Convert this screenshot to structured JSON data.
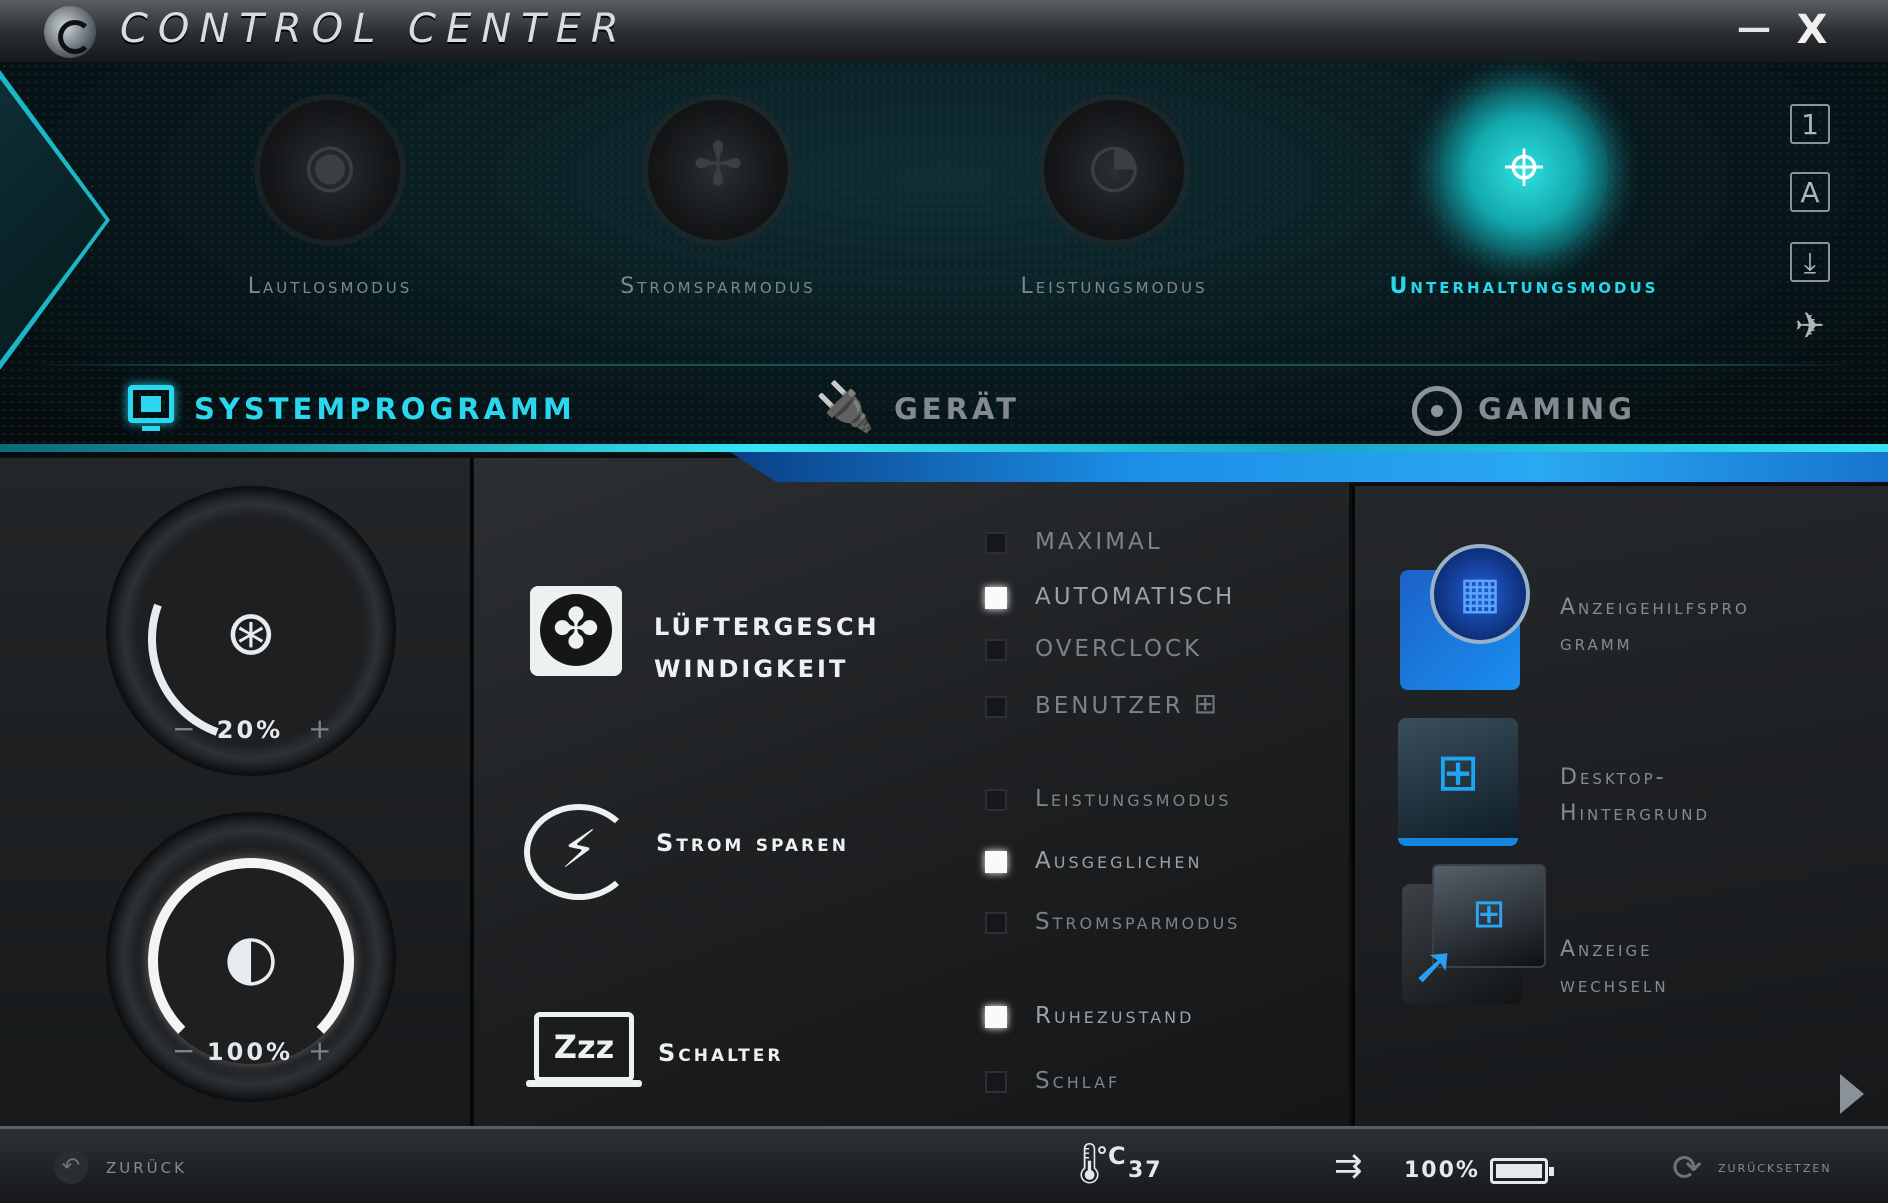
{
  "window": {
    "title": "CONTROL CENTER",
    "minimize_glyph": "—",
    "close_glyph": "X"
  },
  "modes": [
    {
      "label": "Lautlosmodus",
      "active": false,
      "icon": "speaker-icon"
    },
    {
      "label": "Stromsparmodus",
      "active": false,
      "icon": "fan-icon"
    },
    {
      "label": "Leistungsmodus",
      "active": false,
      "icon": "gauge-icon"
    },
    {
      "label": "Unterhaltungsmodus",
      "active": true,
      "icon": "crosshair-icon"
    }
  ],
  "side_icons": [
    {
      "name": "num-lock-icon",
      "glyph": "1"
    },
    {
      "name": "caps-lock-icon",
      "glyph": "A"
    },
    {
      "name": "scroll-lock-icon",
      "glyph": "⤓"
    },
    {
      "name": "airplane-icon",
      "glyph": "✈"
    }
  ],
  "tabs": {
    "system": "SYSTEMPROGRAMM",
    "device": "GERÄT",
    "gaming": "GAMING"
  },
  "dials": {
    "keyboard_backlight": {
      "value": "20%",
      "minus": "−",
      "plus": "+",
      "level": 20
    },
    "brightness": {
      "value": "100%",
      "minus": "−",
      "plus": "+",
      "level": 100
    }
  },
  "features": {
    "fan": {
      "label_line1": "LÜFTERGESCH",
      "label_line2": "WINDIGKEIT",
      "options": [
        {
          "label": "MAXIMAL",
          "checked": false
        },
        {
          "label": "AUTOMATISCH",
          "checked": true
        },
        {
          "label": "OVERCLOCK",
          "checked": false
        },
        {
          "label": "BENUTZER",
          "checked": false
        }
      ]
    },
    "power": {
      "label": "Strom sparen",
      "options": [
        {
          "label": "Leistungsmodus",
          "checked": false
        },
        {
          "label": "Ausgeglichen",
          "checked": true
        },
        {
          "label": "Stromsparmodus",
          "checked": false
        }
      ]
    },
    "switch": {
      "label": "Schalter",
      "icon_text": "Zzz",
      "options": [
        {
          "label": "Ruhezustand",
          "checked": true
        },
        {
          "label": "Schlaf",
          "checked": false
        }
      ]
    }
  },
  "right_items": [
    {
      "label_line1": "Anzeigehilfspro",
      "label_line2": "gramm"
    },
    {
      "label_line1": "Desktop-",
      "label_line2": "Hintergrund"
    },
    {
      "label_line1": "Anzeige",
      "label_line2": "wechseln"
    }
  ],
  "footer": {
    "back_label": "zurück",
    "temp_unit": "°C",
    "temp_value": "37",
    "battery_value": "100%",
    "reset_label": "zurücksetzen"
  },
  "colors": {
    "accent": "#2cd6ee",
    "blue_band": "#1b8fe6",
    "checkbox_on": "#fafafa"
  }
}
